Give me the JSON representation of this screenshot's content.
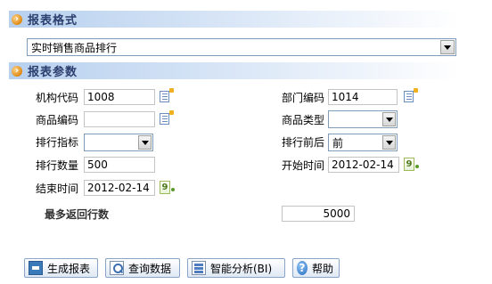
{
  "format_section": {
    "title": "报表格式",
    "report_select": {
      "value": "实时销售商品排行"
    }
  },
  "params_section": {
    "title": "报表参数",
    "fields": {
      "org_code": {
        "label": "机构代码",
        "value": "1008"
      },
      "dept_code": {
        "label": "部门编码",
        "value": "1014"
      },
      "product_code": {
        "label": "商品编码",
        "value": ""
      },
      "product_type": {
        "label": "商品类型",
        "value": ""
      },
      "rank_metric": {
        "label": "排行指标",
        "value": ""
      },
      "rank_order": {
        "label": "排行前后",
        "value": "前"
      },
      "rank_count": {
        "label": "排行数量",
        "value": "500"
      },
      "start_time": {
        "label": "开始时间",
        "value": "2012-02-14"
      },
      "end_time": {
        "label": "结束时间",
        "value": "2012-02-14"
      },
      "max_rows": {
        "label": "最多返回行数",
        "value": "5000"
      }
    }
  },
  "buttons": {
    "generate": "生成报表",
    "query": "查询数据",
    "bi": "智能分析(BI)",
    "help": "帮助"
  },
  "icons": {
    "section_bullet": "orange-circle-arrow-icon",
    "lookup": "list-lookup-icon",
    "calendar": "calendar-icon",
    "help": "question-icon"
  },
  "colors": {
    "section_header": "#b7d0ee",
    "section_title": "#2a3f6e",
    "bullet": "#e08a12"
  }
}
